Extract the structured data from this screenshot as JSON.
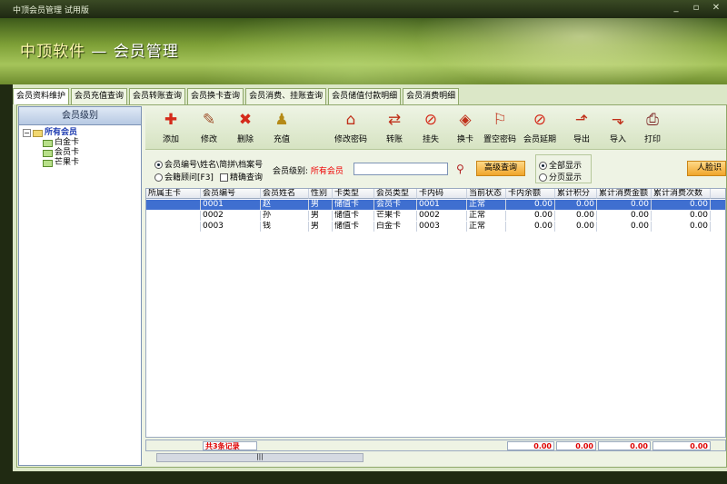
{
  "window": {
    "title": "中顶会员管理 试用版",
    "buttons": [
      "_",
      "▫",
      "✕"
    ]
  },
  "banner": {
    "brand": "中顶软件",
    "subtitle": " — 会员管理"
  },
  "tabs": [
    "会员资料维护",
    "会员充值查询",
    "会员转账查询",
    "会员换卡查询",
    "会员消费、挂账查询",
    "会员储值付款明细",
    "会员消费明细"
  ],
  "tree": {
    "header": "会员级别",
    "root": "所有会员",
    "children": [
      "白金卡",
      "会员卡",
      "芒果卡"
    ]
  },
  "toolbar": [
    {
      "label": "添加",
      "icon": "plus-icon",
      "glyph": "✚",
      "color": "#d42a1a"
    },
    {
      "label": "修改",
      "icon": "wrench-icon",
      "glyph": "✎",
      "color": "#a0522d"
    },
    {
      "label": "删除",
      "icon": "delete-x-icon",
      "glyph": "✖",
      "color": "#d42a1a"
    },
    {
      "label": "充值",
      "icon": "deposit-icon",
      "glyph": "♟",
      "color": "#b58a17"
    },
    {
      "label": "修改密码",
      "icon": "lock-house-icon",
      "glyph": "⌂",
      "color": "#c0301a"
    },
    {
      "label": "转账",
      "icon": "transfer-icon",
      "glyph": "⇄",
      "color": "#c0301a"
    },
    {
      "label": "挂失",
      "icon": "no-entry-icon",
      "glyph": "⊘",
      "color": "#d42a1a"
    },
    {
      "label": "换卡",
      "icon": "swap-card-icon",
      "glyph": "◈",
      "color": "#c0301a"
    },
    {
      "label": "置空密码",
      "icon": "reset-password-icon",
      "glyph": "⚐",
      "color": "#c0301a"
    },
    {
      "label": "会员延期",
      "icon": "extend-icon",
      "glyph": "⊘",
      "color": "#d42a1a"
    },
    {
      "label": "导出",
      "icon": "export-icon",
      "glyph": "⬏",
      "color": "#c0301a"
    },
    {
      "label": "导入",
      "icon": "import-icon",
      "glyph": "⬎",
      "color": "#c0301a"
    },
    {
      "label": "打印",
      "icon": "printer-icon",
      "glyph": "⎙",
      "color": "#7a2020"
    }
  ],
  "filter": {
    "option1": "会员编号\\姓名\\简拼\\档案号",
    "option2": "会籍顾问[F3]",
    "exact": "精确查询",
    "level_label": "会员级别:",
    "level_value": "所有会员",
    "advanced": "高级查询",
    "show_all": "全部显示",
    "paged": "分页显示",
    "face": "人脸识"
  },
  "grid": {
    "columns": [
      "所属主卡",
      "会员编号",
      "会员姓名",
      "性别",
      "卡类型",
      "会员类型",
      "卡内码",
      "当前状态",
      "卡内余额",
      "累计积分",
      "累计消费金额",
      "累计消费次数"
    ],
    "rows": [
      [
        "",
        "0001",
        "赵",
        "男",
        "储值卡",
        "会员卡",
        "0001",
        "正常",
        "0.00",
        "0.00",
        "0.00",
        "0.00"
      ],
      [
        "",
        "0002",
        "孙",
        "男",
        "储值卡",
        "芒果卡",
        "0002",
        "正常",
        "0.00",
        "0.00",
        "0.00",
        "0.00"
      ],
      [
        "",
        "0003",
        "钱",
        "男",
        "储值卡",
        "白金卡",
        "0003",
        "正常",
        "0.00",
        "0.00",
        "0.00",
        "0.00"
      ]
    ],
    "footer_count": "共3条记录",
    "footer_totals": [
      "0.00",
      "0.00",
      "0.00",
      "0.00"
    ]
  }
}
